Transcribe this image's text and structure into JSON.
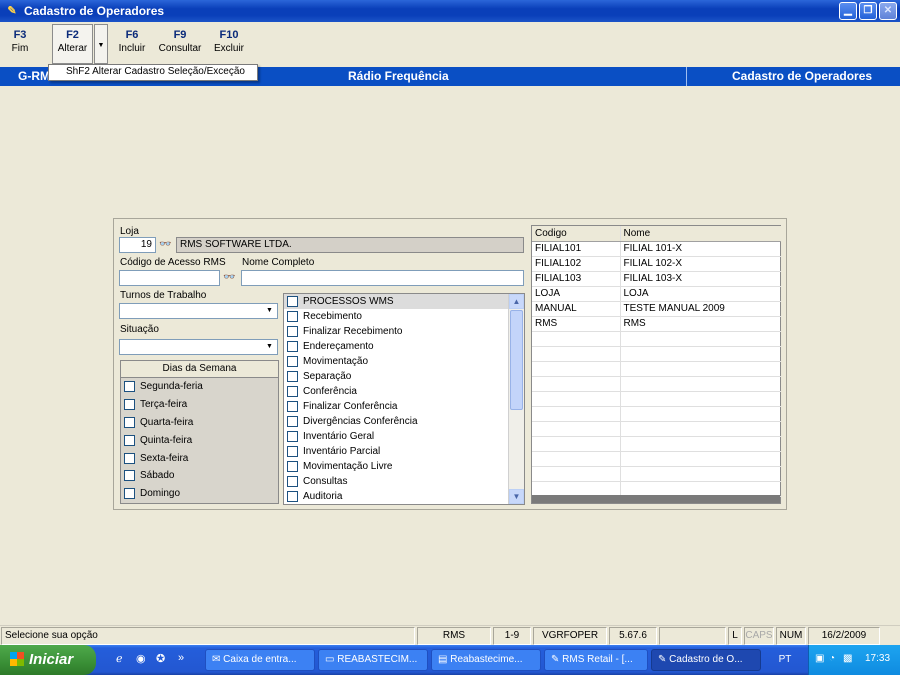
{
  "window": {
    "title": "Cadastro de Operadores"
  },
  "toolbar": {
    "buttons": [
      {
        "key": "F3",
        "label": "Fim"
      },
      {
        "key": "F2",
        "label": "Alterar"
      },
      {
        "key": "F6",
        "label": "Incluir"
      },
      {
        "key": "F9",
        "label": "Consultar"
      },
      {
        "key": "F10",
        "label": "Excluir"
      }
    ],
    "dropdown_item": "ShF2  Alterar Cadastro Seleção/Exceção"
  },
  "header": {
    "left": "G-RM",
    "center": "Rádio Frequência",
    "right": "Cadastro de Operadores"
  },
  "form": {
    "loja_label": "Loja",
    "loja_code": "19",
    "loja_name": "RMS SOFTWARE LTDA.",
    "codigo_label": "Código de Acesso RMS",
    "nome_label": "Nome Completo",
    "codigo_value": "",
    "nome_value": "",
    "turnos_label": "Turnos de Trabalho",
    "turnos_value": "",
    "situacao_label": "Situação",
    "situacao_value": ""
  },
  "dias": {
    "header": "Dias da Semana",
    "items": [
      "Segunda-feria",
      "Terça-feira",
      "Quarta-feira",
      "Quinta-feira",
      "Sexta-feira",
      "Sábado",
      "Domingo"
    ]
  },
  "processos": {
    "items": [
      "PROCESSOS WMS",
      "Recebimento",
      "Finalizar Recebimento",
      "Endereçamento",
      "Movimentação",
      "Separação",
      "Conferência",
      "Finalizar Conferência",
      "Divergências Conferência",
      "Inventário Geral",
      "Inventário Parcial",
      "Movimentação Livre",
      "Consultas",
      "Auditoria"
    ]
  },
  "grid": {
    "columns": [
      "Codigo",
      "Nome"
    ],
    "rows": [
      [
        "FILIAL101",
        "FILIAL 101-X"
      ],
      [
        "FILIAL102",
        "FILIAL 102-X"
      ],
      [
        "FILIAL103",
        "FILIAL 103-X"
      ],
      [
        "LOJA",
        "LOJA"
      ],
      [
        "MANUAL",
        "TESTE MANUAL 2009"
      ],
      [
        "RMS",
        "RMS"
      ]
    ]
  },
  "status": {
    "message": "Selecione sua opção",
    "system": "RMS",
    "range": "1-9",
    "program": "VGRFOPER",
    "version": "5.67.6",
    "l": "L",
    "caps": "CAPS",
    "num": "NUM",
    "date": "16/2/2009"
  },
  "taskbar": {
    "start": "Iniciar",
    "tasks": [
      "Caixa de entra...",
      "REABASTECIM...",
      "Reabastecime...",
      "RMS Retail - [...",
      "Cadastro de O..."
    ],
    "lang": "PT",
    "time": "17:33"
  }
}
